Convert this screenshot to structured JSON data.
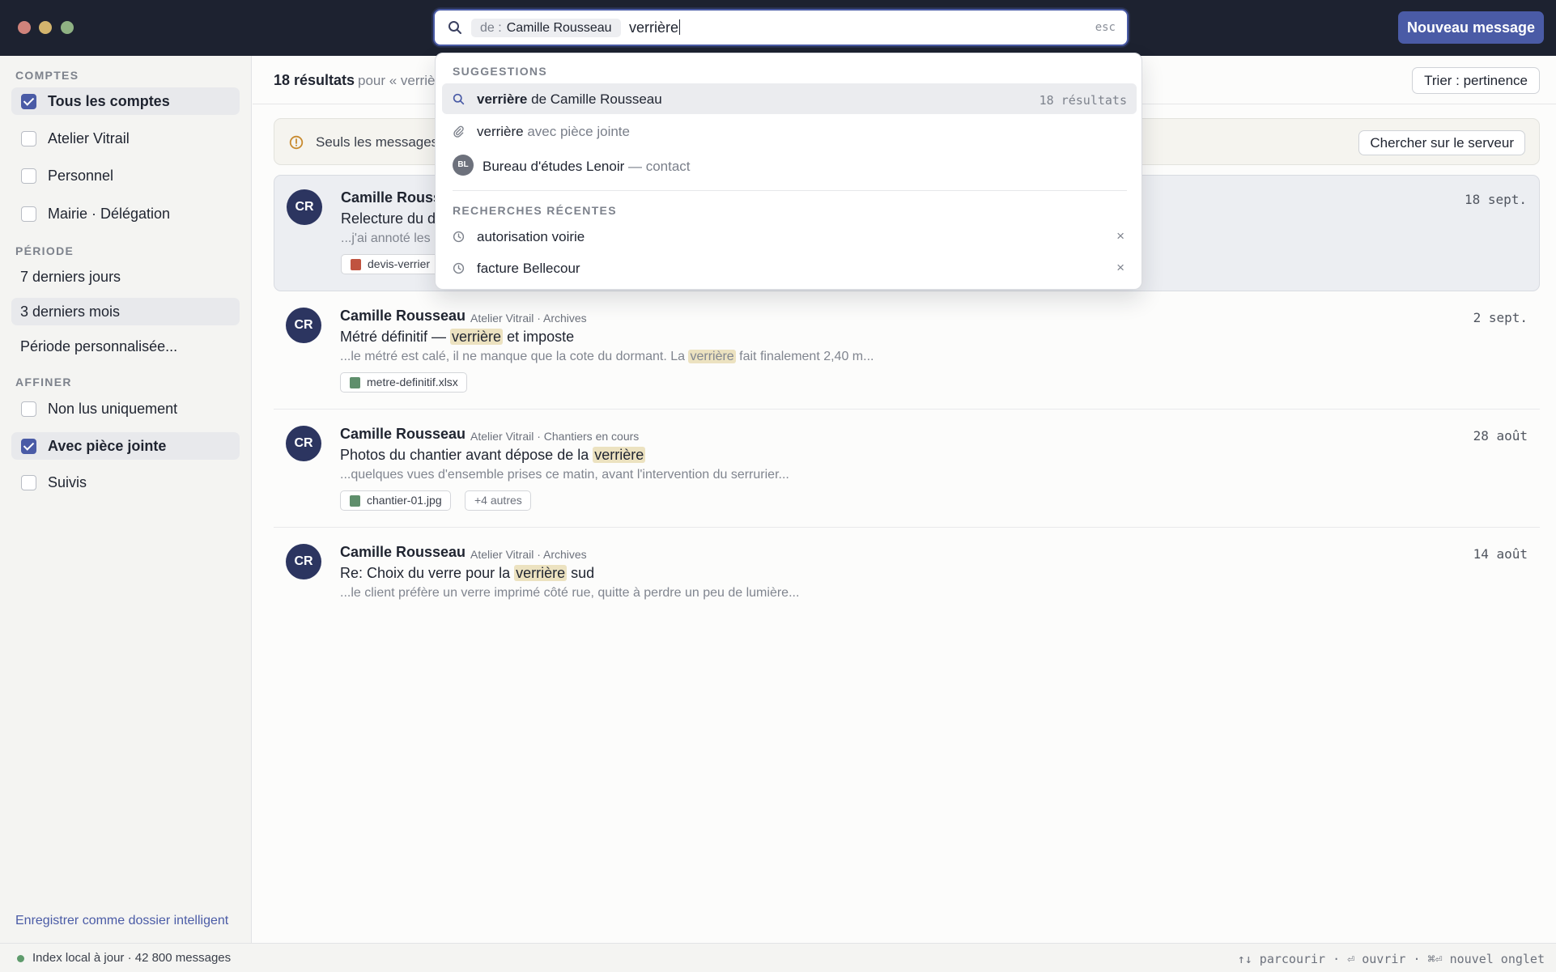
{
  "window": {
    "new_message_label": "Nouveau message"
  },
  "search": {
    "filter_chip_label": "de :",
    "filter_chip_value": "Camille Rousseau",
    "query": "verrière",
    "esc_hint": "esc"
  },
  "dropdown": {
    "suggestions_heading": "SUGGESTIONS",
    "suggestions": [
      {
        "icon": "search-icon",
        "bold": "verrière",
        "rest": " de Camille Rousseau",
        "count": "18 résultats"
      },
      {
        "icon": "paperclip-icon",
        "bold": "verrière",
        "rest": " avec pièce jointe"
      },
      {
        "icon": "contact-avatar",
        "avatar": "BL",
        "bold": "Bureau d'études Lenoir",
        "rest": " — contact"
      }
    ],
    "recent_heading": "RECHERCHES RÉCENTES",
    "recent": [
      {
        "icon": "clock-icon",
        "label": "autorisation voirie",
        "remove": "×"
      },
      {
        "icon": "clock-icon",
        "label": "facture Bellecour",
        "remove": "×"
      }
    ]
  },
  "sidebar": {
    "accounts_heading": "COMPTES",
    "accounts": [
      {
        "label": "Tous les comptes",
        "checked": true
      },
      {
        "label": "Atelier Vitrail",
        "checked": false
      },
      {
        "label": "Personnel",
        "checked": false
      },
      {
        "label": "Mairie · Délégation",
        "checked": false
      }
    ],
    "period_heading": "PÉRIODE",
    "periods": [
      {
        "label": "7 derniers jours",
        "selected": false
      },
      {
        "label": "3 derniers mois",
        "selected": true
      },
      {
        "label": "Période personnalisée...",
        "selected": false
      }
    ],
    "refine_heading": "AFFINER",
    "refine": [
      {
        "label": "Non lus uniquement",
        "checked": false
      },
      {
        "label": "Avec pièce jointe",
        "checked": true
      },
      {
        "label": "Suivis",
        "checked": false
      }
    ],
    "smart_folder_link": "Enregistrer comme dossier intelligent"
  },
  "results": {
    "count": "18 résultats",
    "for_prefix": "pour « verrière »",
    "sort_label": "Trier : pertinence"
  },
  "notice": {
    "text": "Seuls les messages",
    "server_button": "Chercher sur le serveur"
  },
  "messages": [
    {
      "avatar": "CR",
      "from": "Camille Rousseau",
      "folder": "",
      "subject_parts": [
        "Relecture du d"
      ],
      "snippet_parts": [
        "...j'ai annoté les"
      ],
      "date": "18 sept.",
      "attachments": [
        {
          "name": "devis-verrier",
          "color": "#c0533f"
        }
      ]
    },
    {
      "avatar": "CR",
      "from": "Camille Rousseau",
      "folder": "Atelier Vitrail · Archives",
      "subject_parts": [
        "Métré définitif — ",
        "verrière",
        " et imposte"
      ],
      "snippet_parts": [
        "...le métré est calé, il ne manque que la cote du dormant. La ",
        "verrière",
        " fait finalement 2,40 m..."
      ],
      "date": "2 sept.",
      "attachments": [
        {
          "name": "metre-definitif.xlsx",
          "color": "#5f8f6c"
        }
      ]
    },
    {
      "avatar": "CR",
      "from": "Camille Rousseau",
      "folder": "Atelier Vitrail · Chantiers en cours",
      "subject_parts": [
        "Photos du chantier avant dépose de la ",
        "verrière",
        ""
      ],
      "snippet_parts": [
        "...quelques vues d'ensemble prises ce matin, avant l'intervention du serrurier..."
      ],
      "date": "28 août",
      "attachments": [
        {
          "name": "chantier-01.jpg",
          "color": "#5f8f6c"
        },
        {
          "name": "+4 autres",
          "color": ""
        }
      ]
    },
    {
      "avatar": "CR",
      "from": "Camille Rousseau",
      "folder": "Atelier Vitrail · Archives",
      "subject_parts": [
        "Re: Choix du verre pour la ",
        "verrière",
        " sud"
      ],
      "snippet_parts": [
        "...le client préfère un verre imprimé côté rue, quitte à perdre un peu de lumière..."
      ],
      "date": "14 août",
      "attachments": []
    }
  ],
  "status": {
    "index_text": "Index local à jour · 42 800 messages",
    "key_hints": "↑↓ parcourir · ⏎ ouvrir · ⌘⏎ nouvel onglet"
  },
  "colors": {
    "accent": "#4a5ba6",
    "titlebar": "#1d2230",
    "highlight": "#ece2c0",
    "online": "#5e9b6c"
  }
}
